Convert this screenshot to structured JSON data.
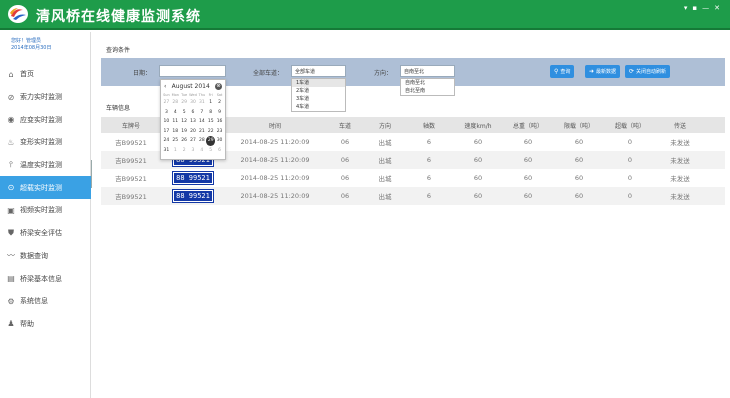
{
  "header": {
    "title": "清风桥在线健康监测系统",
    "controls": [
      "▾",
      "▪",
      "—",
      "✕"
    ]
  },
  "user": {
    "greeting": "您好！管理员",
    "date": "2014年08月30日"
  },
  "sidebar": {
    "items": [
      {
        "label": "首页",
        "icon": "home-icon",
        "glyph": "⌂",
        "active": false
      },
      {
        "label": "索力实时监测",
        "icon": "cable-force-icon",
        "glyph": "⊘",
        "active": false
      },
      {
        "label": "应变实时监测",
        "icon": "eye-icon",
        "glyph": "◉",
        "active": false
      },
      {
        "label": "变形实时监测",
        "icon": "flame-icon",
        "glyph": "♨",
        "active": false
      },
      {
        "label": "温度实时监测",
        "icon": "thermometer-icon",
        "glyph": "⫯",
        "active": false
      },
      {
        "label": "超载实时监测",
        "icon": "dashboard-icon",
        "glyph": "⊙",
        "active": true
      },
      {
        "label": "视频实时监测",
        "icon": "video-icon",
        "glyph": "▣",
        "active": false
      },
      {
        "label": "桥梁安全评估",
        "icon": "shield-icon",
        "glyph": "⛊",
        "active": false
      },
      {
        "label": "数据查询",
        "icon": "chart-line-icon",
        "glyph": "〰",
        "active": false
      },
      {
        "label": "桥梁基本信息",
        "icon": "document-icon",
        "glyph": "▤",
        "active": false
      },
      {
        "label": "系统信息",
        "icon": "gear-icon",
        "glyph": "⚙",
        "active": false
      },
      {
        "label": "帮助",
        "icon": "users-icon",
        "glyph": "♟",
        "active": false
      }
    ]
  },
  "query": {
    "section_title": "查询条件",
    "date_label": "日期：",
    "date_value": "",
    "lane_label": "全部车道：",
    "lane_value": "全部车道",
    "lane_options": [
      "1车道",
      "2车道",
      "3车道",
      "4车道"
    ],
    "direction_label": "方向：",
    "direction_value": "自南至北",
    "direction_options": [
      "自南至北",
      "自北至南"
    ],
    "search_button": "查询",
    "latest_button": "最新数据",
    "auto_refresh_button": "关闭自动刷新"
  },
  "calendar": {
    "month_label": "August 2014",
    "prev": "‹",
    "close": "⊗",
    "day_names": [
      "Sun",
      "Mon",
      "Tue",
      "Wed",
      "Thu",
      "Fri",
      "Sat"
    ],
    "days": [
      {
        "d": "27",
        "o": true
      },
      {
        "d": "28",
        "o": true
      },
      {
        "d": "29",
        "o": true
      },
      {
        "d": "30",
        "o": true
      },
      {
        "d": "31",
        "o": true
      },
      {
        "d": "1"
      },
      {
        "d": "2"
      },
      {
        "d": "3"
      },
      {
        "d": "4"
      },
      {
        "d": "5"
      },
      {
        "d": "6"
      },
      {
        "d": "7"
      },
      {
        "d": "8"
      },
      {
        "d": "9"
      },
      {
        "d": "10"
      },
      {
        "d": "11"
      },
      {
        "d": "12"
      },
      {
        "d": "13"
      },
      {
        "d": "14"
      },
      {
        "d": "15"
      },
      {
        "d": "16"
      },
      {
        "d": "17"
      },
      {
        "d": "18"
      },
      {
        "d": "19"
      },
      {
        "d": "20"
      },
      {
        "d": "21"
      },
      {
        "d": "22"
      },
      {
        "d": "23"
      },
      {
        "d": "24"
      },
      {
        "d": "25"
      },
      {
        "d": "26"
      },
      {
        "d": "27"
      },
      {
        "d": "28"
      },
      {
        "d": "29",
        "t": true
      },
      {
        "d": "30"
      },
      {
        "d": "31"
      },
      {
        "d": "1",
        "o": true
      },
      {
        "d": "2",
        "o": true
      },
      {
        "d": "3",
        "o": true
      },
      {
        "d": "4",
        "o": true
      },
      {
        "d": "5",
        "o": true
      },
      {
        "d": "6",
        "o": true
      }
    ]
  },
  "vehicles": {
    "section_title": "车辆信息",
    "columns": [
      "车牌号",
      "车牌照片",
      "时间",
      "车道",
      "方向",
      "轴数",
      "速度km/h",
      "总重（吨）",
      "限载（吨）",
      "超载（吨）",
      "传送"
    ],
    "rows": [
      {
        "plate": "吉B99521",
        "photo": "",
        "time": "2014-08-25  11:20:09",
        "lane": "06",
        "direction": "出城",
        "axles": "6",
        "speed": "60",
        "total": "60",
        "limit": "60",
        "over": "0",
        "send": "未发送"
      },
      {
        "plate": "吉B99521",
        "photo": "88 99521",
        "time": "2014-08-25  11:20:09",
        "lane": "06",
        "direction": "出城",
        "axles": "6",
        "speed": "60",
        "total": "60",
        "limit": "60",
        "over": "0",
        "send": "未发送"
      },
      {
        "plate": "吉B99521",
        "photo": "88 99521",
        "time": "2014-08-25  11:20:09",
        "lane": "06",
        "direction": "出城",
        "axles": "6",
        "speed": "60",
        "total": "60",
        "limit": "60",
        "over": "0",
        "send": "未发送"
      },
      {
        "plate": "吉B99521",
        "photo": "88 99521",
        "time": "2014-08-25  11:20:09",
        "lane": "06",
        "direction": "出城",
        "axles": "6",
        "speed": "60",
        "total": "60",
        "limit": "60",
        "over": "0",
        "send": "未发送"
      }
    ]
  },
  "colors": {
    "header": "#1e9c4a",
    "active_nav": "#3aa1e4",
    "filter_bar": "#aebfd6",
    "button": "#2f8fe0",
    "plate": "#1338a6"
  }
}
